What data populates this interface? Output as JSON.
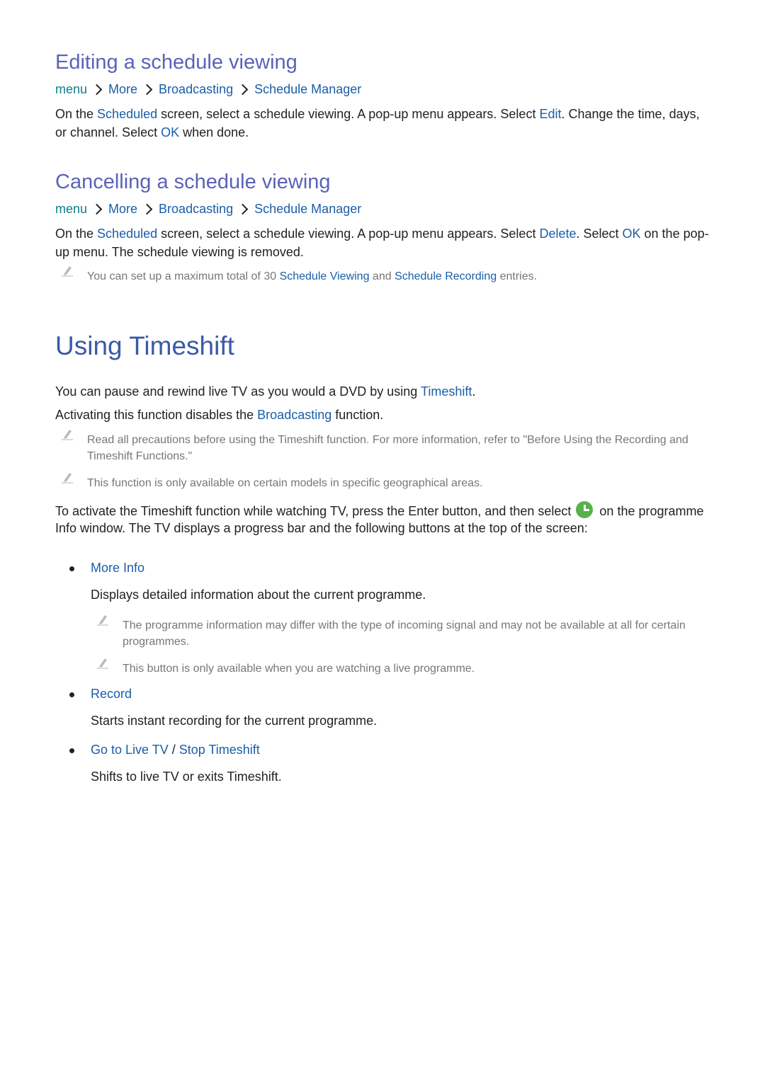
{
  "sections": {
    "editing": {
      "title": "Editing a schedule viewing",
      "breadcrumb": [
        "menu",
        "More",
        "Broadcasting",
        "Schedule Manager"
      ],
      "body": {
        "t1": "On the ",
        "l1": "Scheduled",
        "t2": " screen, select a schedule viewing. A pop-up menu appears. Select ",
        "l2": "Edit",
        "t3": ". Change the time, days, or channel. Select ",
        "l3": "OK",
        "t4": " when done."
      }
    },
    "cancelling": {
      "title": "Cancelling a schedule viewing",
      "breadcrumb": [
        "menu",
        "More",
        "Broadcasting",
        "Schedule Manager"
      ],
      "body": {
        "t1": "On the ",
        "l1": "Scheduled",
        "t2": " screen, select a schedule viewing. A pop-up menu appears. Select ",
        "l2": "Delete",
        "t3": ". Select ",
        "l3": "OK",
        "t4": " on the pop-up menu. The schedule viewing is removed."
      },
      "note": {
        "t1": "You can set up a maximum total of 30 ",
        "l1": "Schedule Viewing",
        "t2": " and ",
        "l2": "Schedule Recording",
        "t3": " entries."
      }
    },
    "timeshift": {
      "title": "Using Timeshift",
      "p1": {
        "t1": "You can pause and rewind live TV as you would a DVD by using ",
        "l1": "Timeshift",
        "t2": "."
      },
      "p2": {
        "t1": "Activating this function disables the ",
        "l1": "Broadcasting",
        "t2": " function."
      },
      "note1": "Read all precautions before using the Timeshift function. For more information, refer to \"Before Using the Recording and Timeshift Functions.\"",
      "note2": "This function is only available on certain models in specific geographical areas.",
      "p3": {
        "t1": "To activate the Timeshift function while watching TV, press the Enter button, and then select ",
        "icon": "timeshift-clock-icon",
        "t2": " on the programme Info window. The TV displays a progress bar and the following buttons at the top of the screen:"
      },
      "items": [
        {
          "label": "More Info",
          "desc": "Displays detailed information about the current programme.",
          "notes": [
            "The programme information may differ with the type of incoming signal and may not be available at all for certain programmes.",
            "This button is only available when you are watching a live programme."
          ]
        },
        {
          "label": "Record",
          "desc": "Starts instant recording for the current programme."
        },
        {
          "label_a": "Go to Live TV",
          "sep": " / ",
          "label_b": "Stop Timeshift",
          "desc": "Shifts to live TV or exits Timeshift."
        }
      ]
    }
  },
  "colors": {
    "section_heading": "#5a62b8",
    "page_heading": "#3a5aa6",
    "link": "#1a5ea8",
    "breadcrumb_first": "#0f7f86",
    "note_text": "#777777",
    "clock_icon": "#5bb04a"
  }
}
